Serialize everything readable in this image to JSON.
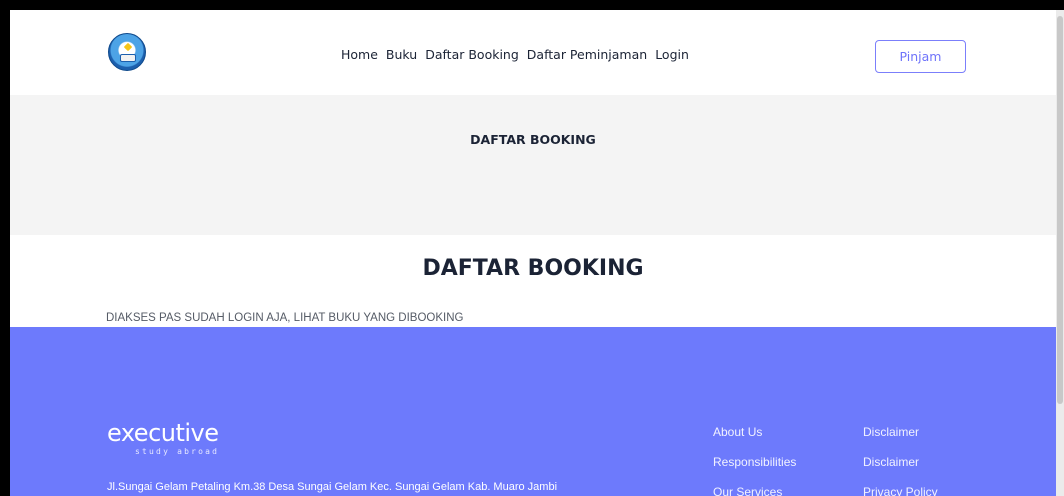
{
  "nav": {
    "items": [
      "Home",
      "Buku",
      "Daftar Booking",
      "Daftar Peminjaman",
      "Login"
    ],
    "cta_label": "Pinjam"
  },
  "banner": {
    "title": "DAFTAR BOOKING"
  },
  "main": {
    "title": "DAFTAR BOOKING",
    "note": "DIAKSES PAS SUDAH LOGIN AJA, LIHAT BUKU YANG DIBOOKING"
  },
  "footer": {
    "brand": "executive",
    "brand_sub": "study abroad",
    "address": "Jl.Sungai Gelam Petaling Km.38 Desa Sungai Gelam Kec. Sungai Gelam Kab. Muaro Jambi",
    "links_col1": [
      "About Us",
      "Responsibilities",
      "Our Services"
    ],
    "links_col2": [
      "Disclaimer",
      "Disclaimer",
      "Privacy Policy"
    ]
  },
  "colors": {
    "footer_bg": "#6d7afc",
    "banner_bg": "#f4f4f4",
    "accent": "#6f74fa",
    "text": "#1b2335"
  }
}
